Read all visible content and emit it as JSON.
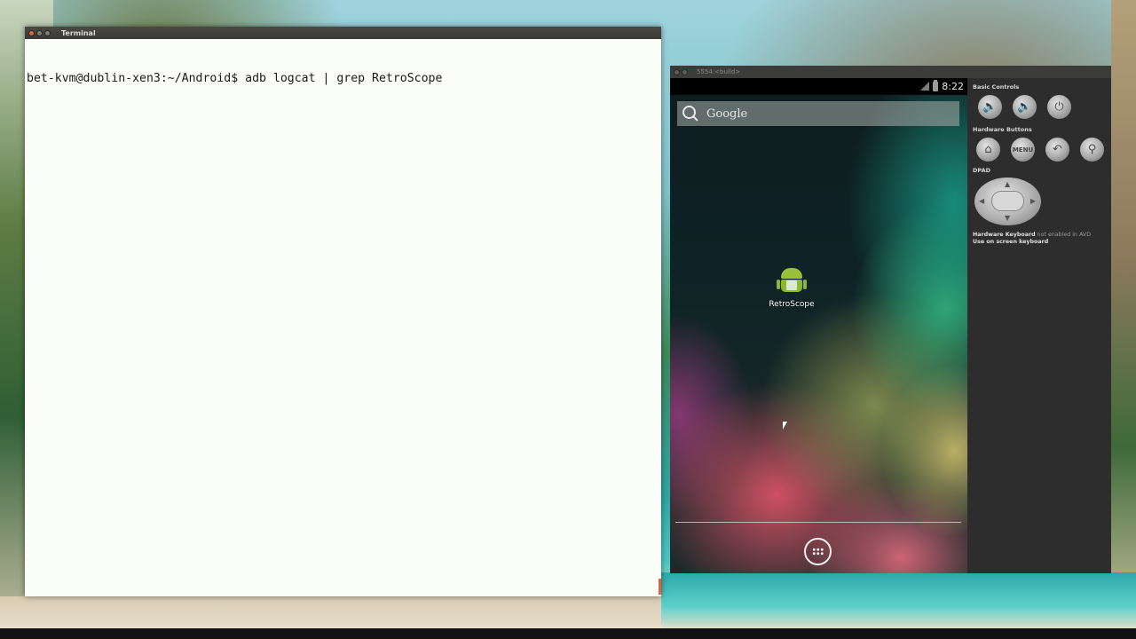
{
  "terminal": {
    "title": "Terminal",
    "prompt_line": "bet-kvm@dublin-xen3:~/Android$ adb logcat | grep RetroScope"
  },
  "emulator": {
    "title": "5554:<build>",
    "status_time": "8:22",
    "search_placeholder": "Google",
    "app_label": "RetroScope",
    "controls": {
      "basic_controls": "Basic Controls",
      "hardware_buttons": "Hardware Buttons",
      "dpad": "DPAD",
      "menu_label": "MENU",
      "keyboard_title": "Hardware Keyboard",
      "keyboard_status": "not enabled in AVD",
      "keyboard_hint": "Use on screen keyboard"
    }
  },
  "icons": [
    "volume-down-icon",
    "volume-up-icon",
    "power-icon",
    "home-icon",
    "back-icon",
    "search-icon",
    "apps-grid-icon",
    "android-app-icon"
  ]
}
